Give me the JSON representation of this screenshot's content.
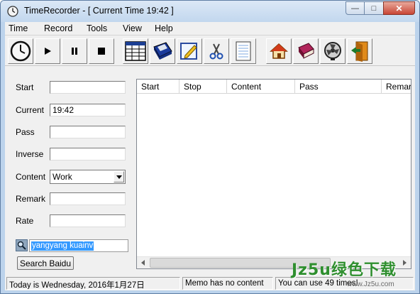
{
  "window": {
    "title": "TimeRecorder - [ Current Time 19:42 ]",
    "minimize_glyph": "—",
    "maximize_glyph": "□",
    "close_glyph": "✕"
  },
  "menu": [
    "Time",
    "Record",
    "Tools",
    "View",
    "Help"
  ],
  "toolbar": [
    {
      "icon": "clock-icon"
    },
    {
      "icon": "play-icon"
    },
    {
      "icon": "pause-icon"
    },
    {
      "icon": "stop-icon"
    },
    {
      "icon": "table-icon"
    },
    {
      "icon": "save-disk-icon"
    },
    {
      "icon": "edit-icon"
    },
    {
      "icon": "scissors-icon"
    },
    {
      "icon": "notepad-icon"
    },
    {
      "icon": "home-icon"
    },
    {
      "icon": "book-icon"
    },
    {
      "icon": "fan-icon"
    },
    {
      "icon": "exit-door-icon"
    }
  ],
  "form": {
    "start_label": "Start",
    "start_value": "",
    "current_label": "Current",
    "current_value": "19:42",
    "pass_label": "Pass",
    "pass_value": "",
    "inverse_label": "Inverse",
    "inverse_value": "",
    "content_label": "Content",
    "content_value": "Work",
    "remark_label": "Remark",
    "remark_value": "",
    "rate_label": "Rate",
    "rate_value": ""
  },
  "search": {
    "value": "yangyang kuainv",
    "button_label": "Search Baidu"
  },
  "table": {
    "columns": [
      "Start",
      "Stop",
      "Content",
      "Pass",
      "Remar"
    ],
    "rows": []
  },
  "statusbar": {
    "date": "Today is Wednesday, 2016年1月27日",
    "memo": "Memo has no content",
    "usage": "You can use 49 times!"
  },
  "watermark": {
    "brand": "Jz5u绿色下载",
    "url": "www.Jz5u.com"
  },
  "colors": {
    "title_bar": "#c2d7ee",
    "close_button": "#c84535",
    "selection": "#3399ff",
    "watermark": "#2f8f2f"
  }
}
